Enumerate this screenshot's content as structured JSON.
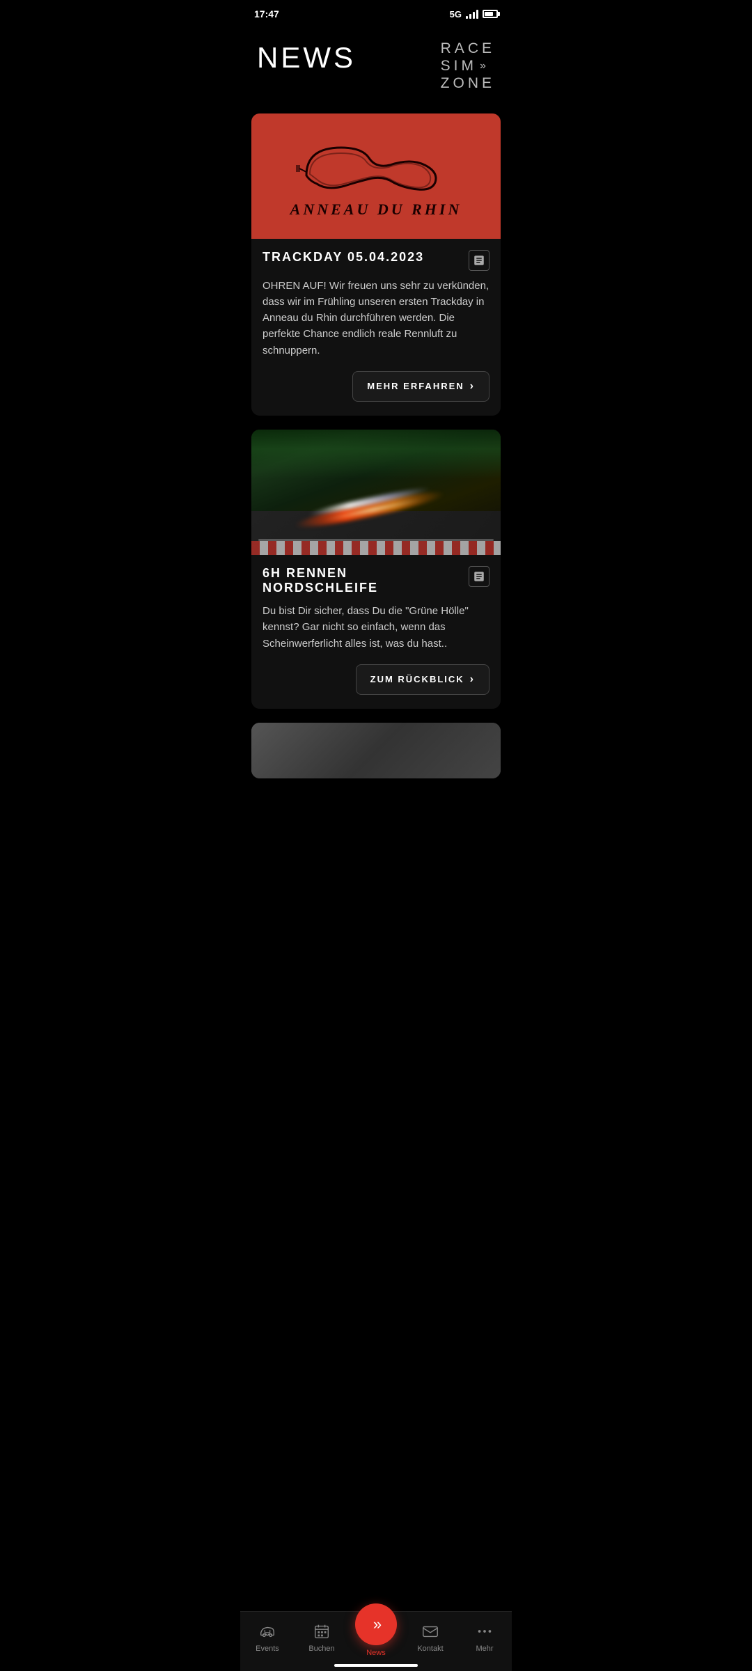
{
  "statusBar": {
    "time": "17:47",
    "network": "5G"
  },
  "header": {
    "title": "NEWS",
    "logo": {
      "line1": "RACE",
      "line2": "SIM",
      "arrows": "»",
      "line3": "ZONE"
    }
  },
  "cards": [
    {
      "id": "card-1",
      "imageType": "red-track",
      "imageLabel": "ANNEAU DU RHIN",
      "title": "TRACKDAY  05.04.2023",
      "description": "OHREN AUF! Wir freuen uns sehr zu verkünden, dass wir im Frühling unseren ersten Trackday in Anneau du Rhin durchführen werden. Die perfekte Chance endlich reale Rennluft zu schnuppern.",
      "buttonLabel": "MEHR ERFAHREN"
    },
    {
      "id": "card-2",
      "imageType": "dark-track",
      "title": "6H RENNEN NORDSCHLEIFE",
      "description": "Du bist Dir sicher, dass Du die \"Grüne Hölle\" kennst? Gar nicht so einfach, wenn das Scheinwerferlicht alles ist, was du hast..",
      "buttonLabel": "ZUM RÜCKBLICK"
    },
    {
      "id": "card-3",
      "imageType": "gray-partial",
      "title": "",
      "description": "",
      "buttonLabel": ""
    }
  ],
  "bottomNav": {
    "items": [
      {
        "id": "events",
        "label": "Events",
        "icon": "car-icon",
        "active": false
      },
      {
        "id": "buchen",
        "label": "Buchen",
        "icon": "calendar-icon",
        "active": false
      },
      {
        "id": "news",
        "label": "News",
        "icon": "news-center-icon",
        "active": true,
        "isCenter": true
      },
      {
        "id": "kontakt",
        "label": "Kontakt",
        "icon": "mail-icon",
        "active": false
      },
      {
        "id": "mehr",
        "label": "Mehr",
        "icon": "more-icon",
        "active": false
      }
    ]
  }
}
